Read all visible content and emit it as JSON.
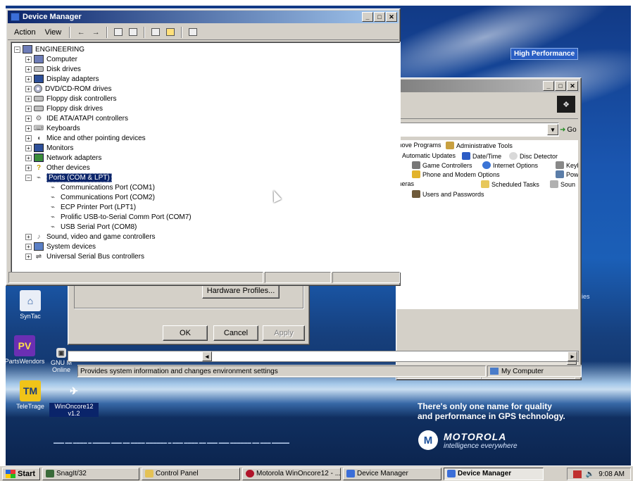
{
  "device_manager": {
    "title": "Device Manager",
    "menus": [
      "Action",
      "View"
    ],
    "root": "ENGINEERING",
    "nodes_before": [
      {
        "label": "Computer",
        "icon": "computer-icon"
      },
      {
        "label": "Disk drives",
        "icon": "disk-drive-icon"
      },
      {
        "label": "Display adapters",
        "icon": "display-adapter-icon"
      },
      {
        "label": "DVD/CD-ROM drives",
        "icon": "cdrom-icon"
      },
      {
        "label": "Floppy disk controllers",
        "icon": "floppy-controller-icon"
      },
      {
        "label": "Floppy disk drives",
        "icon": "floppy-drive-icon"
      },
      {
        "label": "IDE ATA/ATAPI controllers",
        "icon": "ide-controller-icon"
      },
      {
        "label": "Keyboards",
        "icon": "keyboard-icon"
      },
      {
        "label": "Mice and other pointing devices",
        "icon": "mouse-icon"
      },
      {
        "label": "Monitors",
        "icon": "monitor-icon"
      },
      {
        "label": "Network adapters",
        "icon": "network-adapter-icon"
      },
      {
        "label": "Other devices",
        "icon": "unknown-device-icon"
      }
    ],
    "ports_label": "Ports (COM & LPT)",
    "ports": [
      "Communications Port (COM1)",
      "Communications Port (COM2)",
      "ECP Printer Port (LPT1)",
      "Prolific USB-to-Serial Comm Port (COM7)",
      "USB Serial Port (COM8)"
    ],
    "nodes_after": [
      {
        "label": "Sound, video and game controllers",
        "icon": "sound-icon"
      },
      {
        "label": "System devices",
        "icon": "system-device-icon"
      },
      {
        "label": "Universal Serial Bus controllers",
        "icon": "usb-icon"
      }
    ]
  },
  "system_properties": {
    "hardware_profiles_label": "Hardware Profiles...",
    "ok_label": "OK",
    "cancel_label": "Cancel",
    "apply_label": "Apply"
  },
  "control_panel": {
    "go_label": "Go",
    "items": [
      "move Programs",
      "Administrative Tools",
      "Automatic Updates",
      "Date/Time",
      "Disc Detector",
      "Game Controllers",
      "Internet Options",
      "Keyb",
      "Phone and Modem Options",
      "Powe",
      "meras",
      "Scheduled Tasks",
      "Soun",
      "Users and Passwords"
    ],
    "status_text": "Provides system information and changes environment settings",
    "zone_text": "My Computer"
  },
  "desktop": {
    "badge": "High Performance",
    "icons": [
      {
        "label": "SynTac",
        "name": "syntac-icon"
      },
      {
        "label": "PartsWendors",
        "name": "partsvendors-icon"
      },
      {
        "label": "GNU M Online",
        "name": "gnu-online-icon"
      },
      {
        "label": "TeleTrage",
        "name": "teletrage-icon"
      },
      {
        "label": "WinOncore12 v1.2",
        "name": "winoncore-icon"
      }
    ],
    "slogan_line1": "There's only one name for quality",
    "slogan_line2": "and performance in GPS technology.",
    "brand": "MOTOROLA",
    "tagline": "intelligence everywhere",
    "edge_text": "ries"
  },
  "taskbar": {
    "start": "Start",
    "buttons": [
      "SnagIt/32",
      "Control Panel",
      "Motorola WinOncore12 - ...",
      "Device Manager",
      "Device Manager"
    ],
    "clock": "9:08 AM"
  },
  "colors": {
    "title_active": "#0a246a",
    "title_inactive": "#808080",
    "desktop_blue": "#1b5fb7"
  }
}
